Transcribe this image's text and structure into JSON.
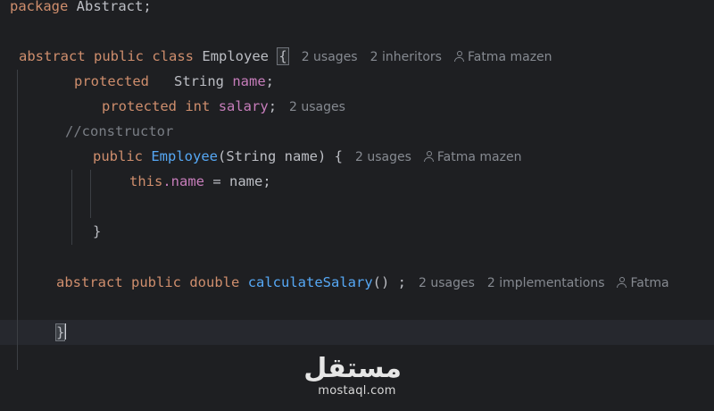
{
  "editor": {
    "package_kw": "package",
    "package_name": " Abstract;",
    "class_line": {
      "kw1": "abstract",
      "kw2": "public",
      "kw3": "class",
      "name": "Employee",
      "brace": "{",
      "hint_usages": "2 usages",
      "hint_inheritors": "2 inheritors",
      "hint_author": "Fatma mazen"
    },
    "field1": {
      "kw": "protected",
      "type": "   String",
      "name": "name",
      "end": ";"
    },
    "field2": {
      "kw": "protected",
      "type": "int",
      "name": "salary",
      "end": ";",
      "hint_usages": "2 usages"
    },
    "comment": "//constructor",
    "ctor": {
      "kw": "public",
      "name": "Employee",
      "params": "(String name) {",
      "hint_usages": "2 usages",
      "hint_author": "Fatma mazen"
    },
    "assign": {
      "this": "this",
      "dot_field": ".name",
      "rest": " = name;"
    },
    "ctor_close": "}",
    "method": {
      "kw1": "abstract",
      "kw2": "public",
      "kw3": "double",
      "name": "calculateSalary",
      "rest": "() ;",
      "hint_usages": "2 usages",
      "hint_impl": "2 implementations",
      "hint_author": "Fatma"
    },
    "class_close": "}"
  },
  "watermark": {
    "arabic": "مستقل",
    "latin": "mostaql.com"
  }
}
